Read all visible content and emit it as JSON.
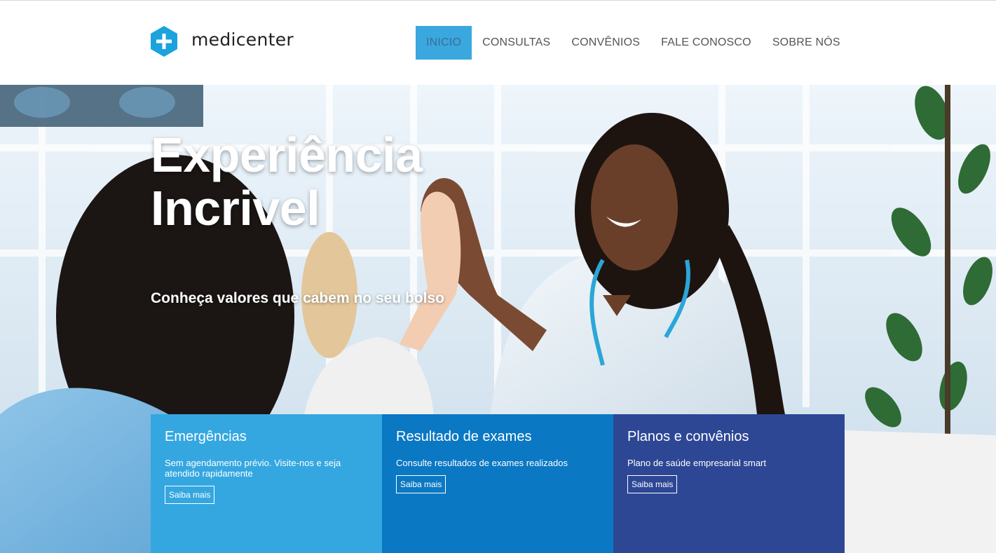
{
  "brand": {
    "name": "medicenter",
    "logo_icon": "plus-hexagon-icon",
    "color": "#1ba3dd"
  },
  "nav": {
    "items": [
      {
        "label": "INICIO",
        "active": true
      },
      {
        "label": "CONSULTAS",
        "active": false
      },
      {
        "label": "CONVÊNIOS",
        "active": false
      },
      {
        "label": "FALE CONOSCO",
        "active": false
      },
      {
        "label": "SOBRE NÓS",
        "active": false
      }
    ],
    "active_color": "#3aa7df"
  },
  "hero": {
    "title": "Experiência Incrivel",
    "subtitle": "Conheça valores que cabem no seu bolso"
  },
  "cards": [
    {
      "title": "Emergências",
      "text": "Sem agendamento prévio. Visite-nos e seja atendido rapidamente",
      "button": "Saiba mais",
      "color": "#35a7e0"
    },
    {
      "title": "Resultado de exames",
      "text": "Consulte resultados de exames realizados",
      "button": "Saiba mais",
      "color": "#0b78c3"
    },
    {
      "title": "Planos e convênios",
      "text": "Plano de saúde empresarial smart",
      "button": "Saiba mais",
      "color": "#2d4795"
    }
  ]
}
